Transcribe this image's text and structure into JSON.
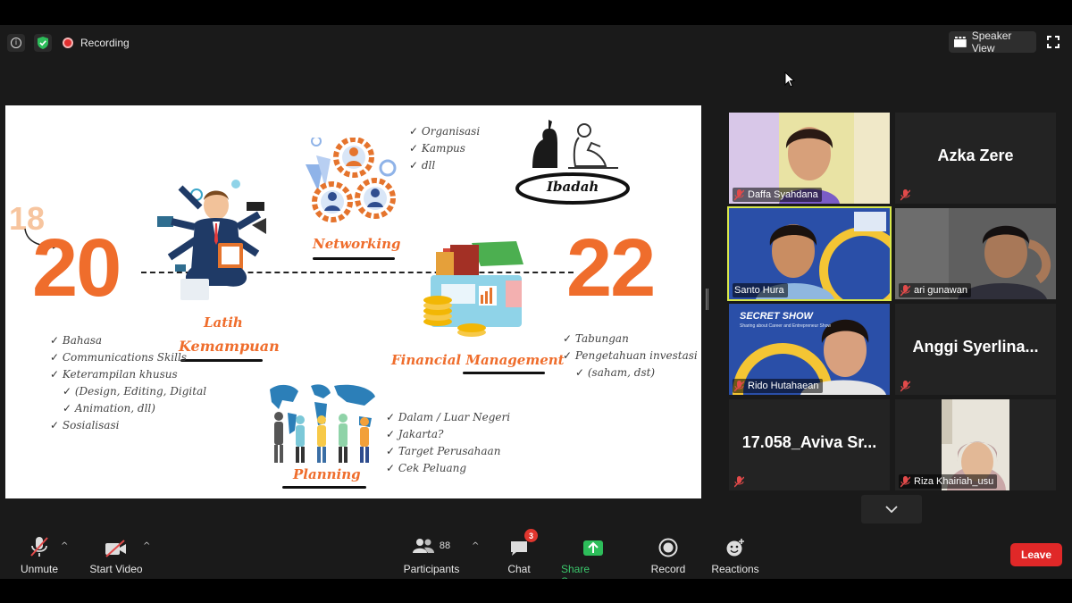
{
  "topbar": {
    "recording_label": "Recording",
    "view_label": "Speaker View"
  },
  "slide": {
    "start_number": "20",
    "prev_number": "18",
    "end_number": "22",
    "sections": {
      "latih": {
        "title_line1": "Latih",
        "title_line2": "Kemampuan",
        "items": [
          "Bahasa",
          "Communications Skills",
          "Keterampilan khusus",
          "(Design, Editing, Digital",
          "Animation, dll)",
          "Sosialisasi"
        ]
      },
      "networking": {
        "title": "Networking",
        "items": [
          "Organisasi",
          "Kampus",
          "dll"
        ]
      },
      "ibadah": {
        "title": "Ibadah"
      },
      "financial": {
        "title": "Financial Management",
        "items": [
          "Tabungan",
          "Pengetahuan investasi",
          "(saham, dst)"
        ]
      },
      "planning": {
        "title": "Planning",
        "items": [
          "Dalam / Luar Negeri",
          "Jakarta?",
          "Target Perusahaan",
          "Cek Peluang"
        ]
      }
    },
    "colors": {
      "accent": "#ef6d2c"
    }
  },
  "gallery": {
    "tiles": [
      {
        "name": "Daffa Syahdana",
        "type": "video",
        "muted": true
      },
      {
        "name": "Azka Zere",
        "type": "name",
        "muted": true
      },
      {
        "name": "Santo Hura",
        "type": "video",
        "muted": false,
        "active": true
      },
      {
        "name": "ari gunawan",
        "type": "video",
        "muted": true
      },
      {
        "name": "Rido Hutahaean",
        "type": "video",
        "muted": true,
        "overlay_title": "SECRET SHOW",
        "overlay_subtitle": "Sharing about Career and Entrepreneur Show"
      },
      {
        "name": "Anggi  Syerlina...",
        "type": "name",
        "muted": true
      },
      {
        "name": "17.058_Aviva  Sr...",
        "type": "name",
        "muted": true
      },
      {
        "name": "Riza Khairiah_usu",
        "type": "video",
        "muted": true
      }
    ]
  },
  "controls": {
    "unmute": "Unmute",
    "start_video": "Start Video",
    "participants": "Participants",
    "participants_count": "88",
    "chat": "Chat",
    "chat_badge": "3",
    "share_screen": "Share Screen",
    "record": "Record",
    "reactions": "Reactions",
    "leave": "Leave"
  }
}
